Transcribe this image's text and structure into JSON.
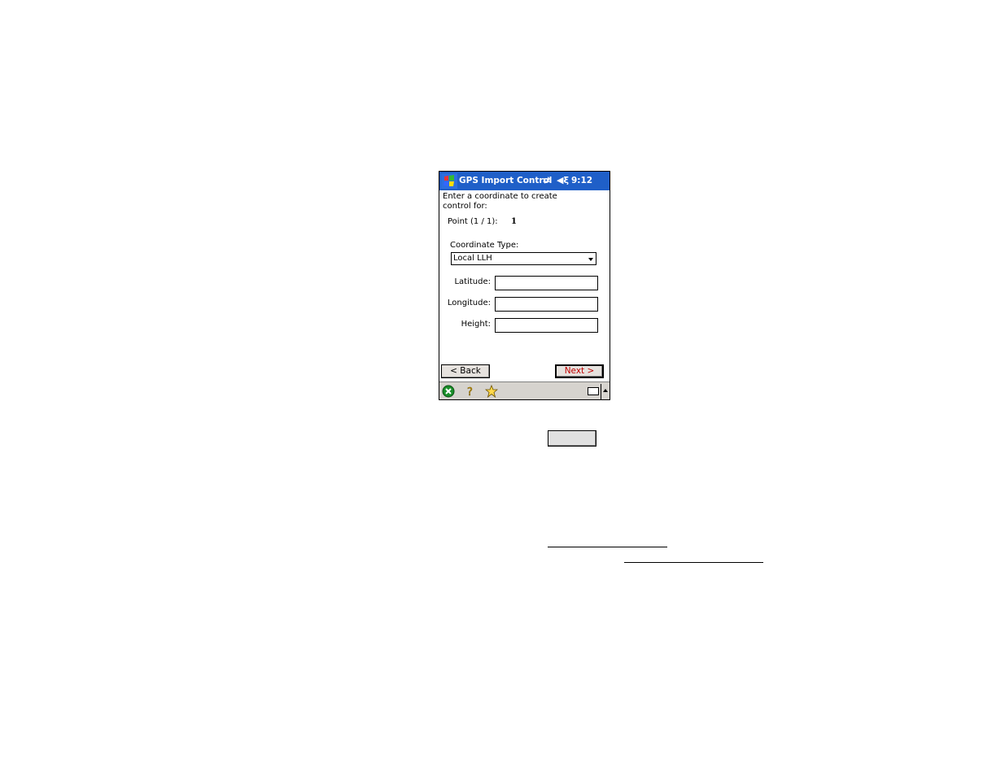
{
  "titlebar": {
    "title": "GPS Import Control",
    "time": "9:12"
  },
  "content": {
    "prompt": "Enter a coordinate to create control for:",
    "point_label": "Point (1 / 1):",
    "point_value": "1",
    "coordinate_type_label": "Coordinate Type:",
    "coordinate_type_value": "Local LLH",
    "fields": {
      "latitude_label": "Latitude:",
      "longitude_label": "Longitude:",
      "height_label": "Height:",
      "latitude_value": "",
      "longitude_value": "",
      "height_value": ""
    },
    "back_button": "< Back",
    "next_button": "Next >"
  },
  "taskbar": {
    "icons": [
      "close-icon",
      "help-icon",
      "favorites-icon",
      "keyboard-icon"
    ]
  },
  "colors": {
    "titlebar": "#1f5fc8",
    "next_text": "#c00000",
    "taskbar": "#d6d3ce"
  }
}
